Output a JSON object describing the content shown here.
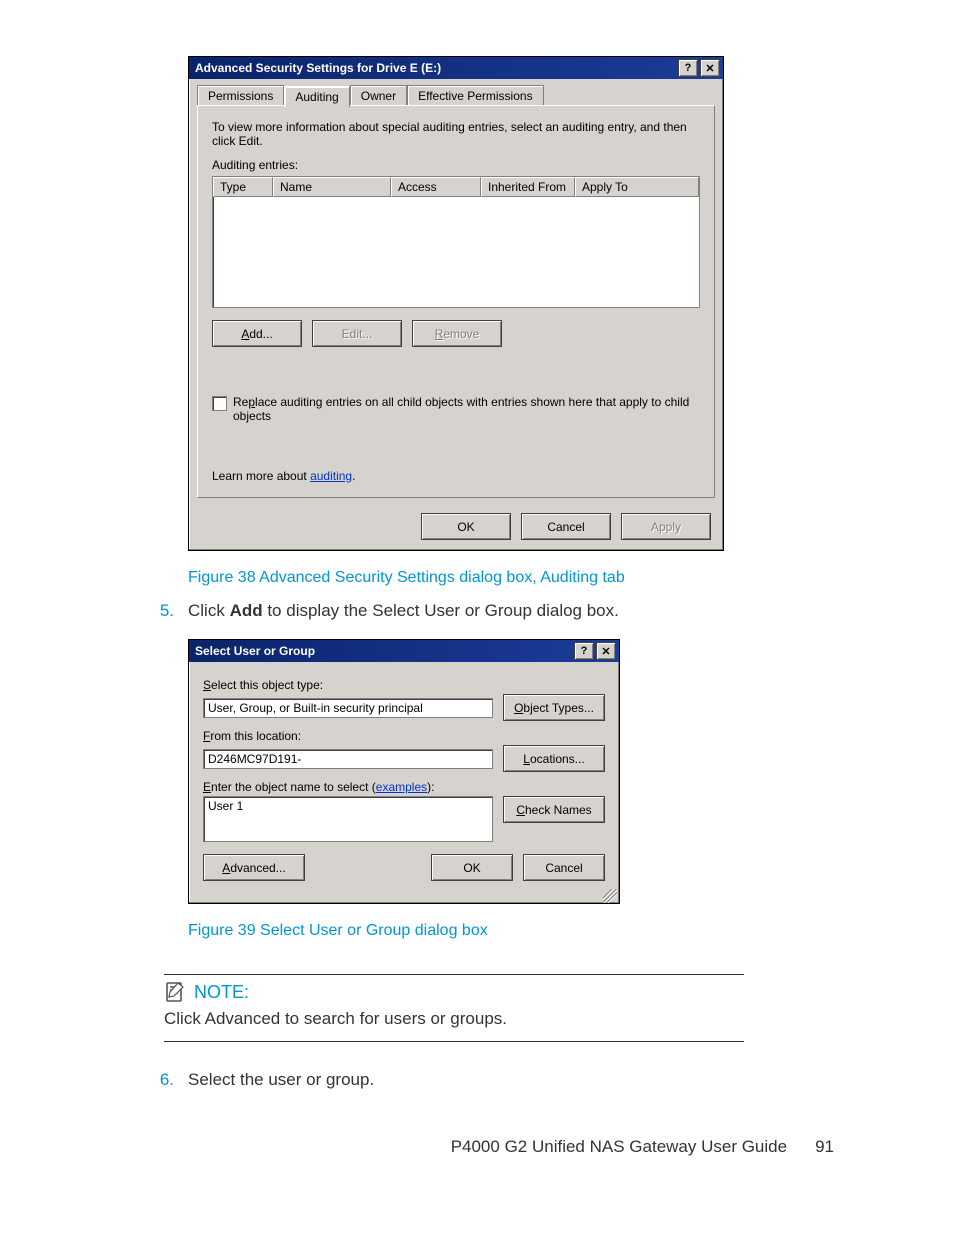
{
  "dialog1": {
    "title": "Advanced Security Settings for Drive E (E:)",
    "tabs": [
      "Permissions",
      "Auditing",
      "Owner",
      "Effective Permissions"
    ],
    "instruction": "To view more information about special auditing entries, select an auditing entry, and then click Edit.",
    "list_label": "Auditing entries:",
    "columns": [
      "Type",
      "Name",
      "Access",
      "Inherited From",
      "Apply To"
    ],
    "buttons": {
      "add": "Add...",
      "edit": "Edit...",
      "remove": "Remove"
    },
    "checkbox_text": "Replace auditing entries on all child objects with entries shown here that apply to child objects",
    "learn_prefix": "Learn more about ",
    "learn_link": "auditing",
    "dlg_buttons": {
      "ok": "OK",
      "cancel": "Cancel",
      "apply": "Apply"
    }
  },
  "fig38": "Figure 38 Advanced Security Settings dialog box, Auditing tab",
  "step5_num": "5.",
  "step5_pre": "Click ",
  "step5_bold": "Add",
  "step5_post": " to display the Select User or Group dialog box.",
  "dialog2": {
    "title": "Select User or Group",
    "lbl_obj": "Select this object type:",
    "val_obj": "User, Group, or Built-in security principal",
    "btn_obj": "Object Types...",
    "lbl_loc": "From this location:",
    "val_loc": "D246MC97D191-",
    "btn_loc": "Locations...",
    "lbl_name_pre": "Enter the object name to select (",
    "lbl_name_link": "examples",
    "lbl_name_post": "):",
    "val_name": "User 1",
    "btn_check": "Check Names",
    "btn_adv": "Advanced...",
    "btn_ok": "OK",
    "btn_cancel": "Cancel"
  },
  "fig39": "Figure 39 Select User or Group dialog box",
  "note_label": "NOTE:",
  "note_body": "Click Advanced to search for users or groups.",
  "step6_num": "6.",
  "step6_text": "Select the user or group.",
  "footer_title": "P4000 G2 Unified NAS Gateway User Guide",
  "footer_page": "91"
}
